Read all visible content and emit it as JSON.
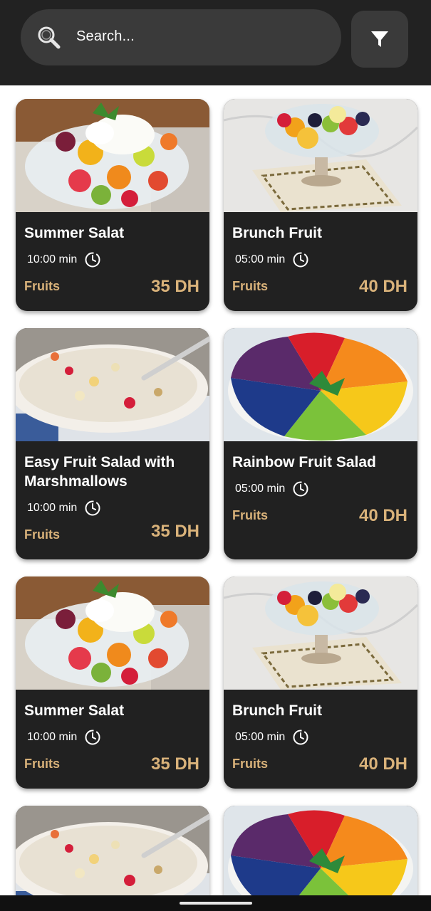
{
  "search": {
    "placeholder": "Search..."
  },
  "colors": {
    "appbar": "#222222",
    "field": "#3a3a3a",
    "card": "#212121",
    "accent": "#d9b27a"
  },
  "icons": {
    "search": "magnifier-icon",
    "filter": "funnel-icon",
    "time": "clock-icon"
  },
  "cards": [
    {
      "title": "Summer Salat",
      "time": "10:00 min",
      "category": "Fruits",
      "price": "35 DH",
      "image": "yogurt-fruit-bowl"
    },
    {
      "title": "Brunch Fruit",
      "time": "05:00 min",
      "category": "Fruits",
      "price": "40 DH",
      "image": "fruit-goblet"
    },
    {
      "title": "Easy Fruit Salad with Marshmallows",
      "time": "10:00 min",
      "category": "Fruits",
      "price": "35 DH",
      "image": "creamy-marshmallow-salad"
    },
    {
      "title": "Rainbow Fruit Salad",
      "time": "05:00 min",
      "category": "Fruits",
      "price": "40 DH",
      "image": "rainbow-fruit-platter"
    },
    {
      "title": "Summer Salat",
      "time": "10:00 min",
      "category": "Fruits",
      "price": "35 DH",
      "image": "yogurt-fruit-bowl"
    },
    {
      "title": "Brunch Fruit",
      "time": "05:00 min",
      "category": "Fruits",
      "price": "40 DH",
      "image": "fruit-goblet"
    },
    {
      "title": "",
      "time": "",
      "category": "",
      "price": "",
      "image": "creamy-marshmallow-salad"
    },
    {
      "title": "",
      "time": "",
      "category": "",
      "price": "",
      "image": "rainbow-fruit-platter"
    }
  ]
}
